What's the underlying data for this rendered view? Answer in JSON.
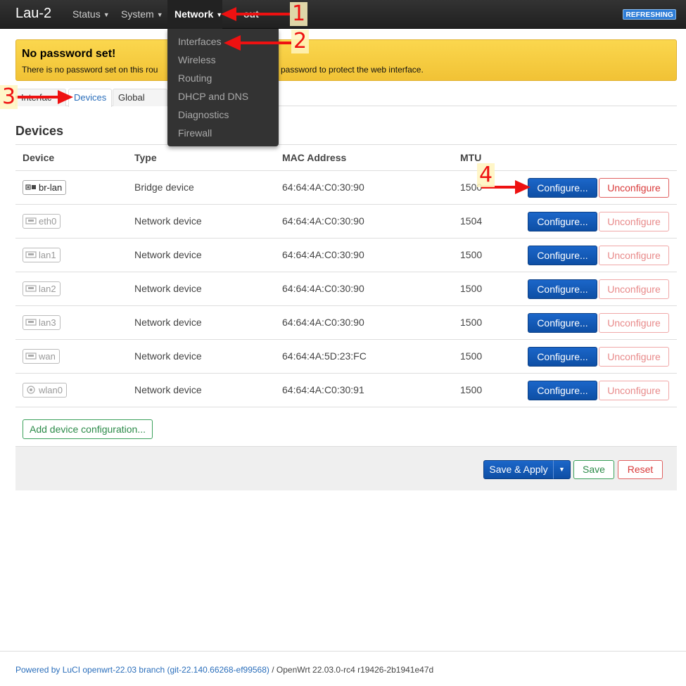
{
  "navbar": {
    "brand": "Lau-2",
    "menus": [
      {
        "label": "Status"
      },
      {
        "label": "System"
      },
      {
        "label": "Network"
      },
      {
        "label": "out"
      }
    ],
    "badge": "REFRESHING"
  },
  "dropdown": {
    "items": [
      "Interfaces",
      "Wireless",
      "Routing",
      "DHCP and DNS",
      "Diagnostics",
      "Firewall"
    ]
  },
  "alert": {
    "title": "No password set!",
    "text_left": "There is no password set on this rou",
    "text_right": "password to protect the web interface."
  },
  "tabs": [
    "Interfac",
    "Devices",
    "Global netw"
  ],
  "section_title": "Devices",
  "table": {
    "headers": [
      "Device",
      "Type",
      "MAC Address",
      "MTU"
    ],
    "rows": [
      {
        "device": "br-lan",
        "type": "Bridge device",
        "mac": "64:64:4A:C0:30:90",
        "mtu": "1500"
      },
      {
        "device": "eth0",
        "type": "Network device",
        "mac": "64:64:4A:C0:30:90",
        "mtu": "1504"
      },
      {
        "device": "lan1",
        "type": "Network device",
        "mac": "64:64:4A:C0:30:90",
        "mtu": "1500"
      },
      {
        "device": "lan2",
        "type": "Network device",
        "mac": "64:64:4A:C0:30:90",
        "mtu": "1500"
      },
      {
        "device": "lan3",
        "type": "Network device",
        "mac": "64:64:4A:C0:30:90",
        "mtu": "1500"
      },
      {
        "device": "wan",
        "type": "Network device",
        "mac": "64:64:4A:5D:23:FC",
        "mtu": "1500"
      },
      {
        "device": "wlan0",
        "type": "Network device",
        "mac": "64:64:4A:C0:30:91",
        "mtu": "1500"
      }
    ],
    "configure_label": "Configure...",
    "unconfigure_label": "Unconfigure"
  },
  "add_device_label": "Add device configuration...",
  "actions": {
    "save_apply": "Save & Apply",
    "save": "Save",
    "reset": "Reset"
  },
  "footer": {
    "powered": "Powered by LuCI openwrt-22.03 branch (git-22.140.66268-ef99568)",
    "version": " / OpenWrt 22.03.0-rc4 r19426-2b1941e47d"
  },
  "annotations": [
    "1",
    "2",
    "3",
    "4"
  ],
  "colors": {
    "navbar": "#222222",
    "primary": "#0e4fa5",
    "danger": "#d93a3a",
    "success": "#2b8a48",
    "alert": "#f5c842",
    "annotation": "#ee1111"
  }
}
